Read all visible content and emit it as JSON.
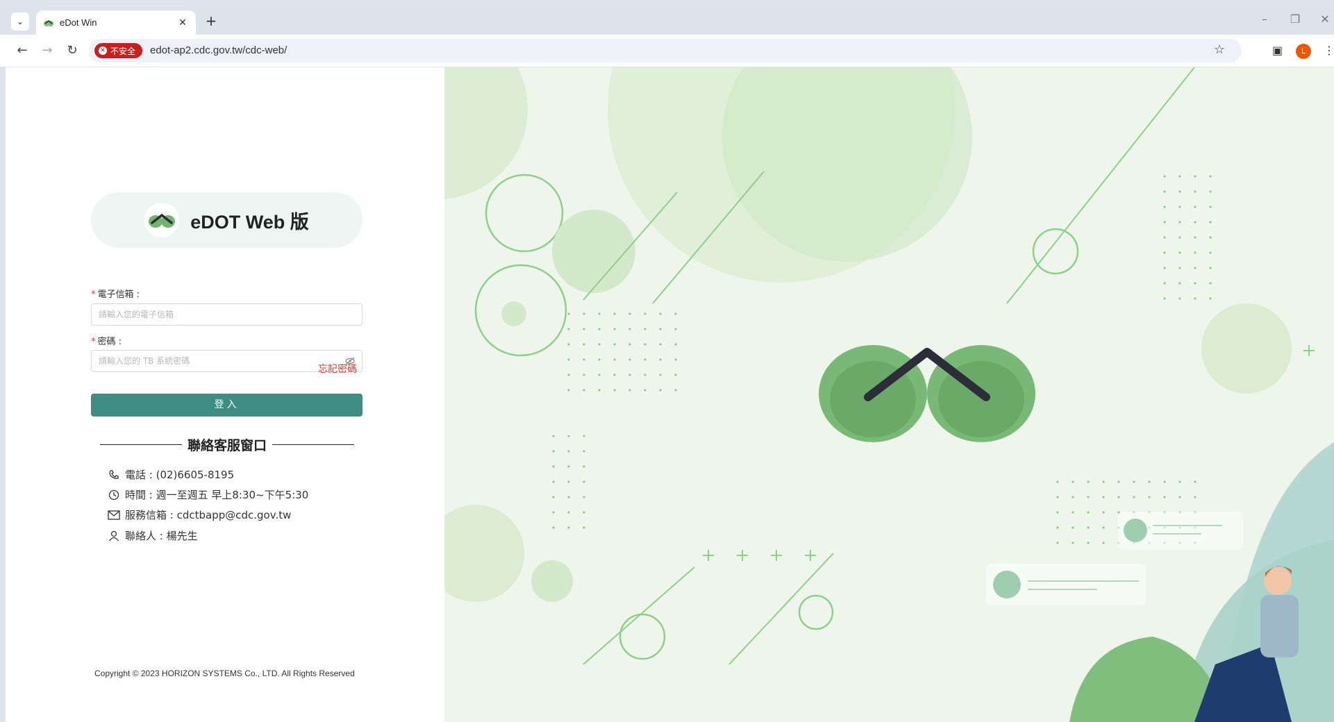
{
  "browser": {
    "tab_title": "eDot Win",
    "url": "edot-ap2.cdc.gov.tw/cdc-web/",
    "security_label": "不安全",
    "profile_initial": "L"
  },
  "login": {
    "brand_name": "eDOT Web 版",
    "email_label": "電子信箱 :",
    "email_placeholder": "請輸入您的電子信箱",
    "password_label": "密碼 :",
    "password_placeholder": "請輸入您的 TB 系統密碼",
    "required_mark": "*",
    "forgot_password": "忘記密碼",
    "submit_label": "登入"
  },
  "contact": {
    "title": "聯絡客服窗口",
    "phone": "電話 : (02)6605-8195",
    "hours": "時間 : 週一至週五 早上8:30~下午5:30",
    "email": "服務信箱 : cdctbapp@cdc.gov.tw",
    "person": "聯絡人 : 楊先生"
  },
  "footer": {
    "copyright": "Copyright © 2023 HORIZON SYSTEMS Co., LTD. All Rights Reserved"
  },
  "colors": {
    "primary": "#3d8d82",
    "danger": "#e53935",
    "leaf": "#7bbf74"
  }
}
